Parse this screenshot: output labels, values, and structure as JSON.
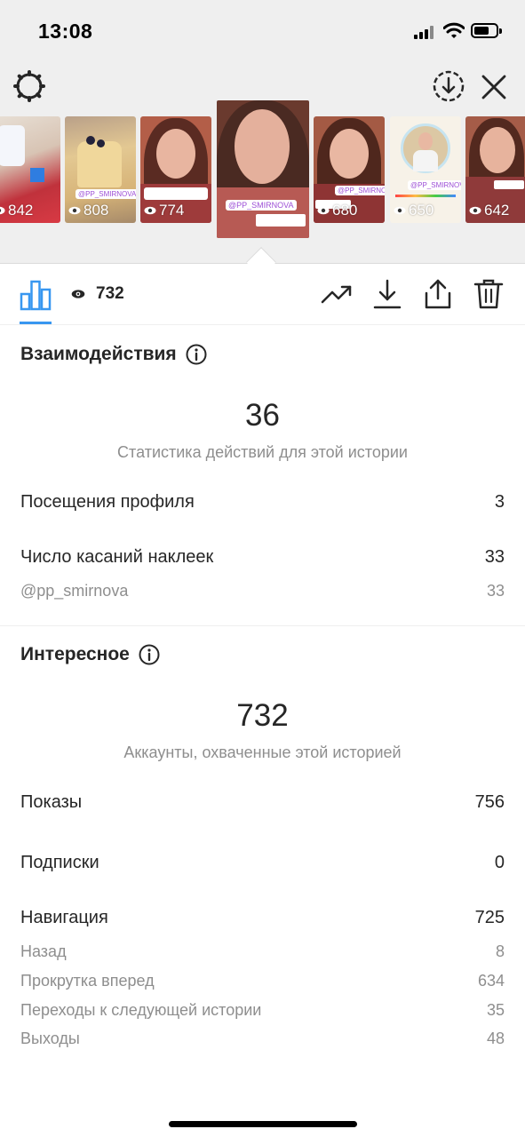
{
  "status_bar": {
    "time": "13:08"
  },
  "stories": {
    "thumbnails": [
      {
        "views": "842",
        "tag": ""
      },
      {
        "views": "808",
        "tag": "@PP_SMIRNOVA"
      },
      {
        "views": "774",
        "tag": ""
      },
      {
        "views": "",
        "tag": "@PP_SMIRNOVA",
        "selected": true
      },
      {
        "views": "680",
        "tag": "@PP_SMIRNOVA"
      },
      {
        "views": "650",
        "tag": "@PP_SMIRNOVA"
      },
      {
        "views": "642",
        "tag": ""
      }
    ]
  },
  "toolbar": {
    "views": "732"
  },
  "interactions": {
    "title": "Взаимодействия",
    "total": "36",
    "caption": "Статистика действий для этой истории",
    "profile_visits_label": "Посещения профиля",
    "profile_visits_value": "3",
    "sticker_taps_label": "Число касаний наклеек",
    "sticker_taps_value": "33",
    "sticker_handle_label": "@pp_smirnova",
    "sticker_handle_value": "33"
  },
  "discovery": {
    "title": "Интересное",
    "total": "732",
    "caption": "Аккаунты, охваченные этой историей",
    "impressions_label": "Показы",
    "impressions_value": "756",
    "follows_label": "Подписки",
    "follows_value": "0",
    "navigation_label": "Навигация",
    "navigation_value": "725",
    "back_label": "Назад",
    "back_value": "8",
    "forward_label": "Прокрутка вперед",
    "forward_value": "634",
    "next_story_label": "Переходы к следующей истории",
    "next_story_value": "35",
    "exits_label": "Выходы",
    "exits_value": "48"
  },
  "colors": {
    "accent": "#3897f0",
    "text": "#262626",
    "secondary": "#8e8e8e",
    "top_bg": "#efefef"
  }
}
